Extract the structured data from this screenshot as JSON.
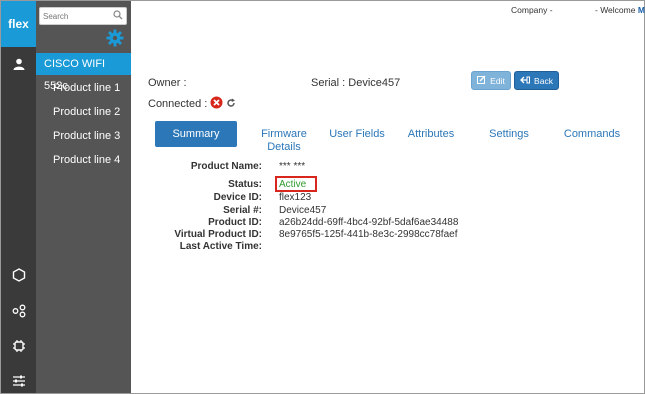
{
  "rail": {
    "logo": "flex",
    "icons": [
      "user-icon",
      "hexagon-icon",
      "share-nodes-icon",
      "chip-icon",
      "sliders-icon"
    ]
  },
  "sidebar": {
    "search_placeholder": "Search",
    "items": [
      {
        "label": "CISCO WIFI 552c",
        "active": true
      },
      {
        "label": "Product line 1"
      },
      {
        "label": "Product line 2"
      },
      {
        "label": "Product line 3"
      },
      {
        "label": "Product line 4"
      }
    ]
  },
  "topbar": {
    "company": "Company -",
    "welcome": "- Welcome",
    "welcome_user": "M"
  },
  "device": {
    "owner_label": "Owner :",
    "serial_label": "Serial : Device457",
    "connected_label": "Connected :"
  },
  "buttons": {
    "edit": "Edit",
    "back": "Back"
  },
  "tabs": {
    "summary": "Summary",
    "firmware_line1": "Firmware",
    "firmware_line2": "Details",
    "user_fields": "User Fields",
    "attributes": "Attributes",
    "settings": "Settings",
    "commands": "Commands"
  },
  "details": [
    {
      "label": "Product Name:",
      "value": "*** ***"
    },
    {
      "label": "Status:",
      "value": "Active"
    },
    {
      "label": "Device ID:",
      "value": "flex123"
    },
    {
      "label": "Serial #:",
      "value": "Device457"
    },
    {
      "label": "Product ID:",
      "value": "a26b24dd-69ff-4bc4-92bf-5daf6ae34488"
    },
    {
      "label": "Virtual Product ID:",
      "value": "8e9765f5-125f-441b-8e3c-2998cc78faef"
    },
    {
      "label": "Last Active Time:",
      "value": ""
    }
  ],
  "colors": {
    "accent": "#1a9bd7",
    "button_primary": "#2c77b8",
    "status_active": "#2e9a2e",
    "highlight_box": "#d9261c"
  }
}
